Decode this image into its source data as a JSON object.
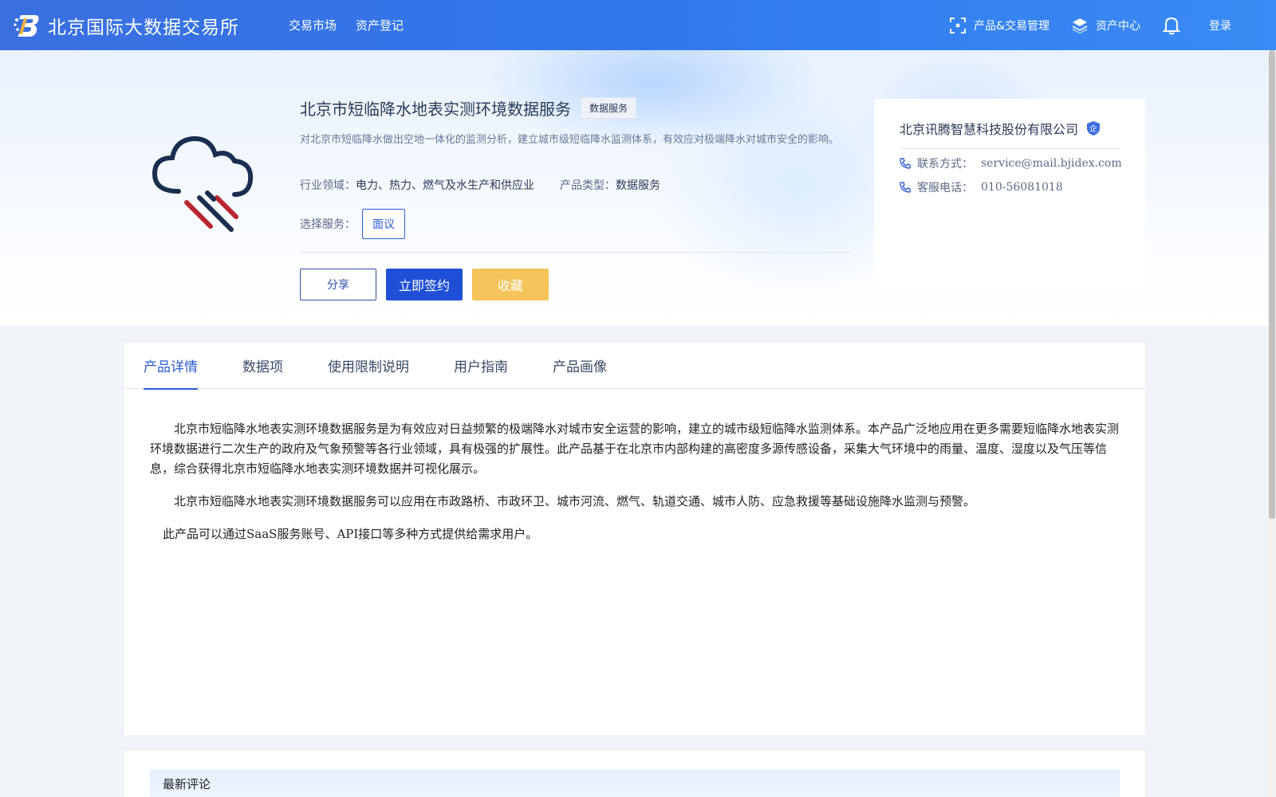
{
  "header": {
    "site_title": "北京国际大数据交易所",
    "nav": [
      {
        "label": "交易市场"
      },
      {
        "label": "资产登记"
      }
    ],
    "right": {
      "product_mgmt": "产品&交易管理",
      "asset_center": "资产中心",
      "login": "登录"
    }
  },
  "product": {
    "title": "北京市短临降水地表实测环境数据服务",
    "tag": "数据服务",
    "description": "对北京市短临降水做出空地一体化的监测分析，建立城市级短临降水监测体系，有效应对极端降水对城市安全的影响。",
    "industry_label": "行业领域：",
    "industry_value": "电力、热力、燃气及水生产和供应业",
    "type_label": "产品类型：",
    "type_value": "数据服务",
    "service_label": "选择服务：",
    "service_option": "面议",
    "buttons": {
      "share": "分享",
      "sign": "立即签约",
      "favorite": "收藏"
    }
  },
  "company": {
    "name": "北京讯腾智慧科技股份有限公司",
    "badge": "企",
    "contact_label": "联系方式：",
    "contact_value": "service@mail.bjidex.com",
    "phone_label": "客服电话：",
    "phone_value": "010-56081018"
  },
  "tabs": [
    {
      "label": "产品详情",
      "active": true
    },
    {
      "label": "数据项"
    },
    {
      "label": "使用限制说明"
    },
    {
      "label": "用户指南"
    },
    {
      "label": "产品画像"
    }
  ],
  "detail": {
    "para1": "北京市短临降水地表实测环境数据服务是为有效应对日益频繁的极端降水对城市安全运营的影响，建立的城市级短临降水监测体系。本产品广泛地应用在更多需要短临降水地表实测环境数据进行二次生产的政府及气象预警等各行业领域，具有极强的扩展性。此产品基于在北京市内部构建的高密度多源传感设备，采集大气环境中的雨量、温度、湿度以及气压等信息，综合获得北京市短临降水地表实测环境数据并可视化展示。",
    "para2": "北京市短临降水地表实测环境数据服务可以应用在市政路桥、市政环卫、城市河流、燃气、轨道交通、城市人防、应急救援等基础设施降水监测与预警。",
    "para3": "此产品可以通过SaaS服务账号、API接口等多种方式提供给需求用户。"
  },
  "comments": {
    "title": "最新评论"
  },
  "colors": {
    "primary": "#2d5dd6",
    "header_start": "#3a6fe0",
    "favorite": "#f5c45a",
    "sign": "#1e4fd6"
  }
}
